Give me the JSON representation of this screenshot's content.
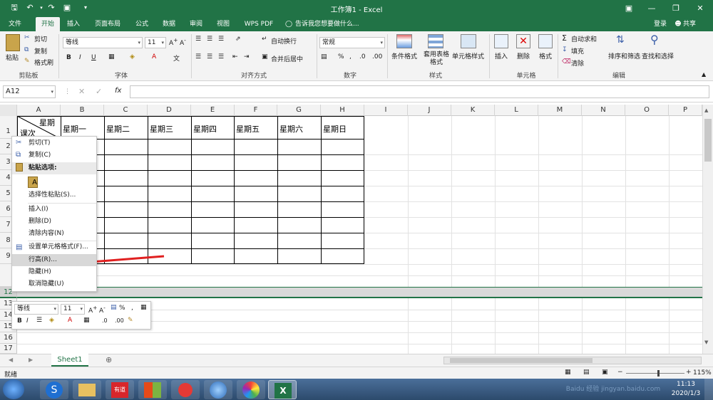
{
  "window": {
    "title": "工作簿1 - Excel"
  },
  "tabs": [
    "文件",
    "开始",
    "插入",
    "页面布局",
    "公式",
    "数据",
    "审阅",
    "视图",
    "WPS PDF"
  ],
  "active_tab": "开始",
  "tell_me": "告诉我您想要做什么...",
  "account": {
    "login": "登录",
    "share": "共享"
  },
  "ribbon": {
    "clipboard": {
      "label": "剪贴板",
      "paste": "粘贴",
      "cut": "剪切",
      "copy": "复制",
      "format_painter": "格式刷"
    },
    "font": {
      "label": "字体",
      "name": "等线",
      "size": "11",
      "bold": "B",
      "italic": "I",
      "underline": "U"
    },
    "align": {
      "label": "对齐方式",
      "wrap": "自动换行",
      "merge": "合并后居中"
    },
    "number": {
      "label": "数字",
      "format": "常规",
      "percent": "%"
    },
    "styles": {
      "label": "样式",
      "conditional": "条件格式",
      "table": "套用表格格式",
      "cell": "单元格样式"
    },
    "cells": {
      "label": "单元格",
      "insert": "插入",
      "delete": "删除",
      "format": "格式"
    },
    "edit": {
      "label": "编辑",
      "autosum": "自动求和",
      "fill": "填充",
      "clear": "清除",
      "sort": "排序和筛选",
      "find": "查找和选择"
    }
  },
  "formula_bar": {
    "name_box": "A12",
    "fx": "fx",
    "value": ""
  },
  "columns": [
    "A",
    "B",
    "C",
    "D",
    "E",
    "F",
    "G",
    "H",
    "I",
    "J",
    "K",
    "L",
    "M",
    "N",
    "O",
    "P"
  ],
  "rows": [
    "1",
    "2",
    "3",
    "4",
    "5",
    "6",
    "7",
    "8",
    "9",
    "12",
    "13",
    "14",
    "15",
    "16",
    "17"
  ],
  "table": {
    "corner_top": "星期",
    "corner_bottom": "课次",
    "headers": [
      "星期一",
      "星期二",
      "星期三",
      "星期四",
      "星期五",
      "星期六",
      "星期日"
    ]
  },
  "context_menu": {
    "cut": "剪切(T)",
    "copy": "复制(C)",
    "paste_options": "粘贴选项:",
    "paste_special": "选择性粘贴(S)...",
    "insert": "插入(I)",
    "delete": "删除(D)",
    "clear": "清除内容(N)",
    "format_cells": "设置单元格格式(F)...",
    "row_height": "行高(R)...",
    "hide": "隐藏(H)",
    "unhide": "取消隐藏(U)"
  },
  "mini_toolbar": {
    "font": "等线",
    "size": "11"
  },
  "sheet": {
    "name": "Sheet1"
  },
  "status": {
    "text": "就绪",
    "zoom": "115%"
  },
  "clock": {
    "time": "11:13",
    "date": "2020/1/3"
  },
  "watermark": "Baidu 经验 jingyan.baidu.com",
  "colors": {
    "brand": "#217346",
    "arrow": "#e02020"
  }
}
